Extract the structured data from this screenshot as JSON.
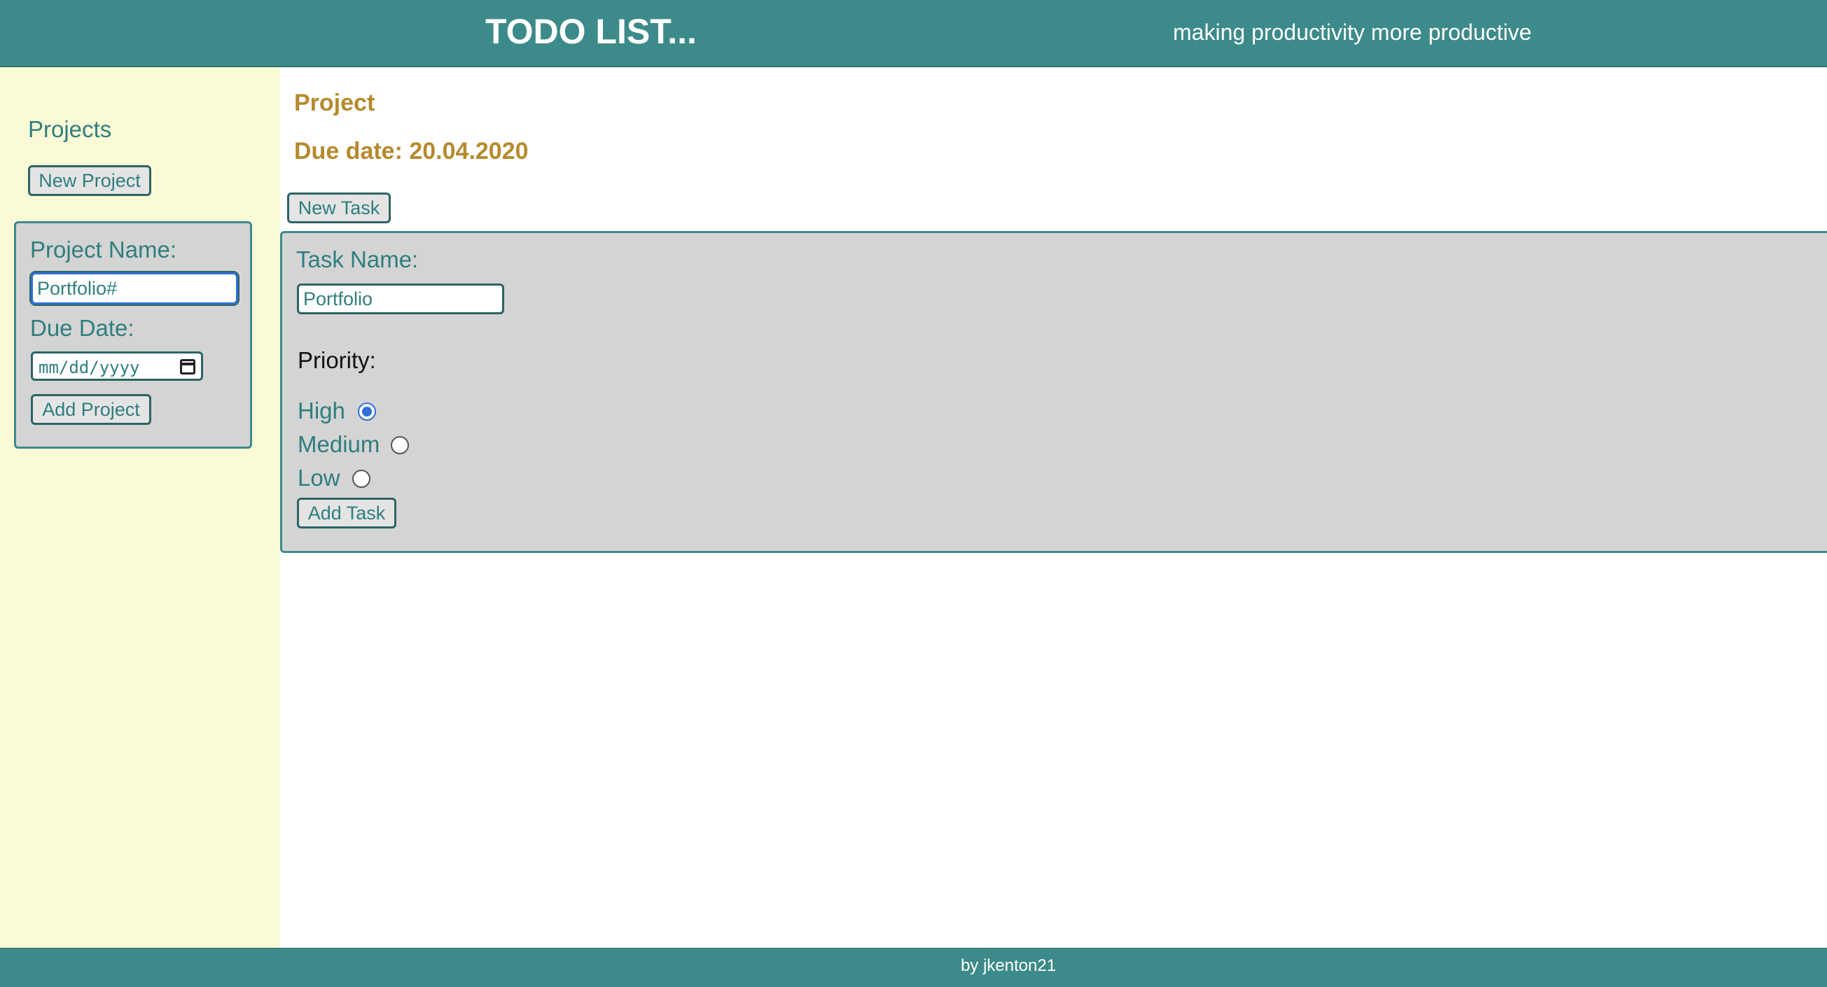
{
  "header": {
    "title": "TODO LIST...",
    "tagline": "making productivity more productive"
  },
  "sidebar": {
    "heading": "Projects",
    "new_project_button": "New Project",
    "project_form": {
      "name_label": "Project Name:",
      "name_value": "Portfolio#",
      "due_label": "Due Date:",
      "due_placeholder": "mm/dd/yyyy",
      "add_button": "Add Project"
    }
  },
  "main": {
    "project_title": "Project",
    "due_date": "Due date: 20.04.2020",
    "new_task_button": "New Task",
    "task_form": {
      "name_label": "Task Name:",
      "name_value": "Portfolio",
      "priority_label": "Priority:",
      "priorities": [
        {
          "label": "High",
          "checked": true
        },
        {
          "label": "Medium",
          "checked": false
        },
        {
          "label": "Low",
          "checked": false
        }
      ],
      "add_button": "Add Task"
    }
  },
  "footer": {
    "text": "by jkenton21"
  },
  "colors": {
    "header_bg": "#3d8a8a",
    "sidebar_bg": "#fafad7",
    "accent_teal": "#2f7e7e",
    "project_gold": "#b58a2e",
    "form_bg": "#d4d4d4",
    "radio_blue": "#2f6fd6"
  }
}
